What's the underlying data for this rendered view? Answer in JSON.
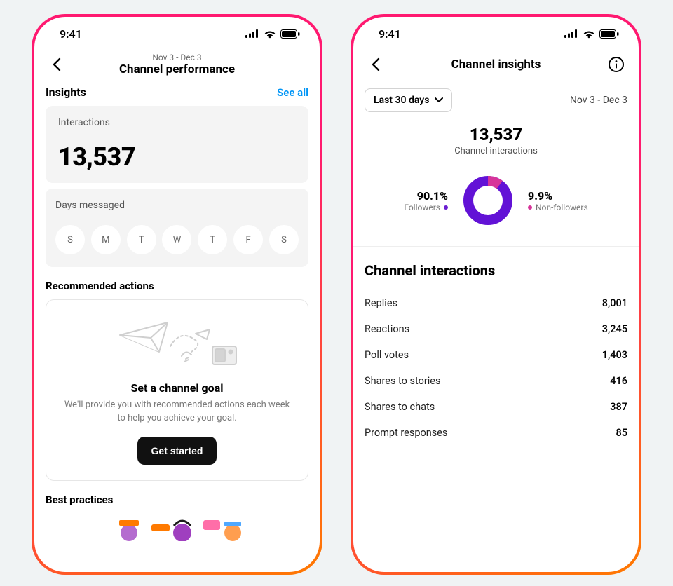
{
  "status": {
    "time": "9:41"
  },
  "left": {
    "header_date": "Nov 3 - Dec 3",
    "header_title": "Channel performance",
    "insights_label": "Insights",
    "see_all": "See all",
    "interactions_card": {
      "label": "Interactions",
      "value": "13,537"
    },
    "days_card": {
      "label": "Days messaged",
      "days": [
        "S",
        "M",
        "T",
        "W",
        "T",
        "F",
        "S"
      ]
    },
    "recommended": {
      "section_title": "Recommended actions",
      "title": "Set a channel goal",
      "body": "We'll provide you with recommended actions each week to help you achieve your goal.",
      "button": "Get started"
    },
    "best_practices": {
      "section_title": "Best practices"
    }
  },
  "right": {
    "header_title": "Channel insights",
    "range_label": "Last 30 days",
    "range_date": "Nov 3 - Dec 3",
    "total": {
      "value": "13,537",
      "label": "Channel interactions"
    },
    "followers": {
      "pct": "90.1%",
      "label": "Followers"
    },
    "nonfollowers": {
      "pct": "9.9%",
      "label": "Non-followers"
    },
    "ci_title": "Channel interactions",
    "stats": [
      {
        "label": "Replies",
        "value": "8,001"
      },
      {
        "label": "Reactions",
        "value": "3,245"
      },
      {
        "label": "Poll votes",
        "value": "1,403"
      },
      {
        "label": "Shares to stories",
        "value": "416"
      },
      {
        "label": "Shares to chats",
        "value": "387"
      },
      {
        "label": "Prompt responses",
        "value": "85"
      }
    ]
  },
  "chart_data": {
    "type": "pie",
    "title": "Channel interactions",
    "categories": [
      "Followers",
      "Non-followers"
    ],
    "values": [
      90.1,
      9.9
    ],
    "colors": [
      "#6212d6",
      "#d7349a"
    ]
  }
}
